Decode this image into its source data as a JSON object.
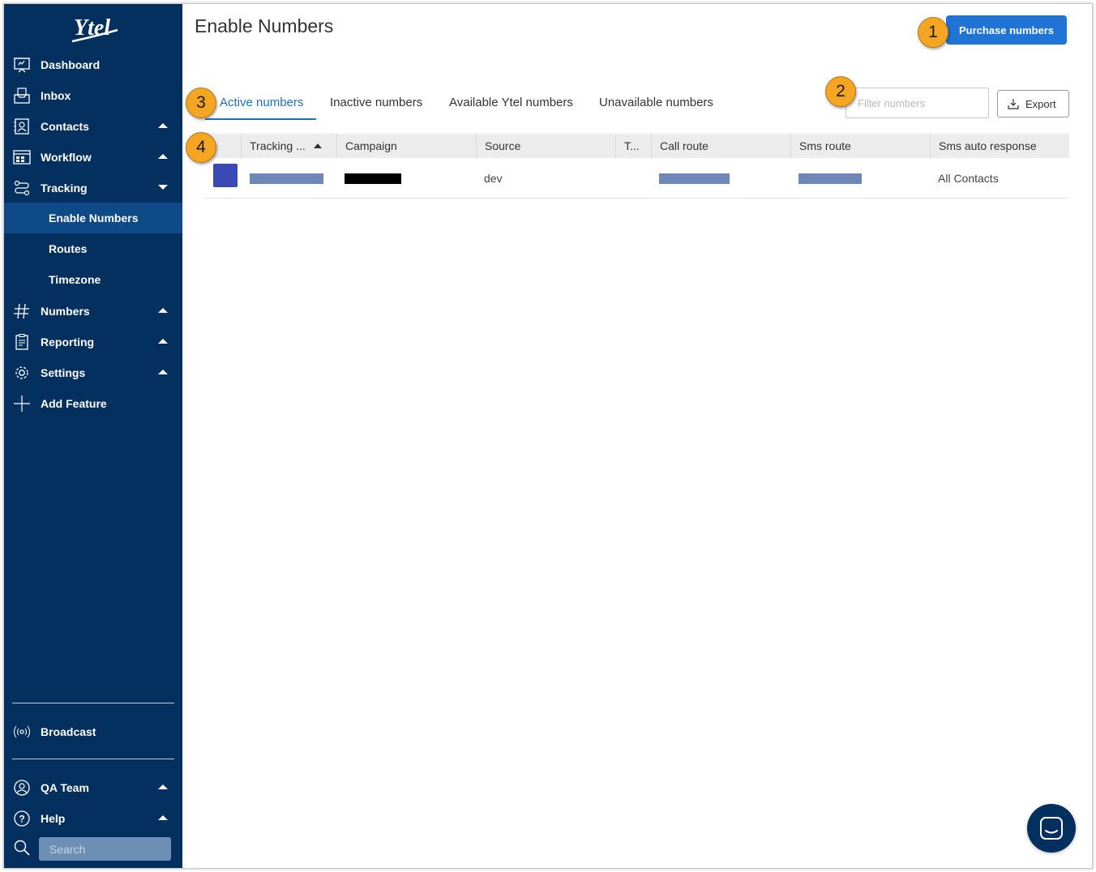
{
  "brand": {
    "logo_text": "Ytel"
  },
  "sidebar": {
    "items": [
      {
        "label": "Dashboard",
        "icon": "dashboard-icon"
      },
      {
        "label": "Inbox",
        "icon": "inbox-icon"
      },
      {
        "label": "Contacts",
        "icon": "contacts-icon",
        "caret": "up"
      },
      {
        "label": "Workflow",
        "icon": "workflow-icon",
        "caret": "up"
      },
      {
        "label": "Tracking",
        "icon": "tracking-icon",
        "caret": "down"
      },
      {
        "label": "Numbers",
        "icon": "hash-icon",
        "caret": "up"
      },
      {
        "label": "Reporting",
        "icon": "clipboard-icon",
        "caret": "up"
      },
      {
        "label": "Settings",
        "icon": "gear-icon",
        "caret": "up"
      },
      {
        "label": "Add Feature",
        "icon": "plus-icon"
      }
    ],
    "tracking_subitems": [
      {
        "label": "Enable Numbers",
        "active": true
      },
      {
        "label": "Routes"
      },
      {
        "label": "Timezone"
      }
    ],
    "broadcast_label": "Broadcast",
    "team_label": "QA Team",
    "help_label": "Help",
    "search_placeholder": "Search"
  },
  "header": {
    "title": "Enable Numbers",
    "purchase_label": "Purchase numbers"
  },
  "tabs": [
    {
      "label": "Active numbers",
      "active": true
    },
    {
      "label": "Inactive numbers"
    },
    {
      "label": "Available Ytel numbers"
    },
    {
      "label": "Unavailable numbers"
    }
  ],
  "filter": {
    "placeholder": "Filter numbers",
    "value": ""
  },
  "export_label": "Export",
  "table": {
    "columns": [
      "Tracking ...",
      "Campaign",
      "Source",
      "T...",
      "Call route",
      "Sms route",
      "Sms auto response"
    ],
    "rows": [
      {
        "tracking": "",
        "campaign": "",
        "source": "dev",
        "t": "",
        "call_route": "",
        "sms_route": "",
        "sms_auto_response": "All Contacts"
      }
    ]
  },
  "callouts": [
    "1",
    "2",
    "3",
    "4"
  ],
  "colors": {
    "sidebar_bg": "#04305f",
    "sidebar_active": "#0d4a87",
    "accent": "#1f74d6",
    "callout": "#f4a623"
  }
}
